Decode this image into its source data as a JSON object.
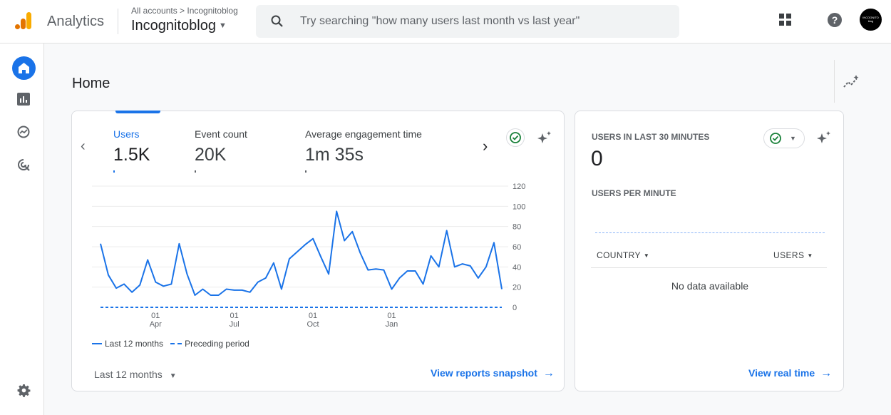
{
  "header": {
    "app_title": "Analytics",
    "breadcrumb": "All accounts > Incognitoblog",
    "property_name": "Incognitoblog",
    "search_placeholder": "Try searching \"how many users last month vs last year\"",
    "avatar_text": "INCOGNITO blog",
    "icons": [
      "apps-grid-icon",
      "help-icon"
    ]
  },
  "nav": {
    "items": [
      {
        "name": "home",
        "icon": "home-icon"
      },
      {
        "name": "reports",
        "icon": "bar-chart-icon"
      },
      {
        "name": "explore",
        "icon": "explore-icon"
      },
      {
        "name": "advertising",
        "icon": "advertising-icon"
      }
    ],
    "admin_icon": "gear-icon"
  },
  "page": {
    "title": "Home"
  },
  "overview": {
    "metrics": [
      {
        "label": "Users",
        "value": "1.5K"
      },
      {
        "label": "Event count",
        "value": "20K"
      },
      {
        "label": "Average engagement time",
        "value": "1m 35s"
      }
    ],
    "legend_current": "Last 12 months",
    "legend_previous": "Preceding period",
    "date_range": "Last 12 months",
    "link": "View reports snapshot",
    "accent": "#1a73e8"
  },
  "realtime": {
    "heading": "USERS IN LAST 30 MINUTES",
    "value": "0",
    "subheading": "USERS PER MINUTE",
    "col_country": "COUNTRY",
    "col_users": "USERS",
    "empty": "No data available",
    "link": "View real time"
  },
  "chart_data": {
    "type": "line",
    "ylim": [
      0,
      120
    ],
    "yticks": [
      "120",
      "100",
      "80",
      "60",
      "40",
      "20",
      "0"
    ],
    "xticks": [
      {
        "day": "01",
        "month": "Apr",
        "index": 7
      },
      {
        "day": "01",
        "month": "Jul",
        "index": 17
      },
      {
        "day": "01",
        "month": "Oct",
        "index": 27
      },
      {
        "day": "01",
        "month": "Jan",
        "index": 37
      }
    ],
    "series": [
      {
        "name": "Last 12 months",
        "style": "solid",
        "values": [
          63,
          32,
          19,
          23,
          15,
          22,
          47,
          25,
          21,
          23,
          63,
          33,
          12,
          18,
          12,
          12,
          18,
          17,
          17,
          15,
          25,
          29,
          44,
          18,
          48,
          55,
          62,
          68,
          50,
          33,
          95,
          66,
          75,
          54,
          37,
          38,
          37,
          18,
          29,
          36,
          36,
          23,
          51,
          40,
          76,
          40,
          43,
          41,
          29,
          40,
          64,
          18
        ]
      },
      {
        "name": "Preceding period",
        "style": "dashed",
        "values": [
          0,
          0
        ]
      }
    ]
  }
}
